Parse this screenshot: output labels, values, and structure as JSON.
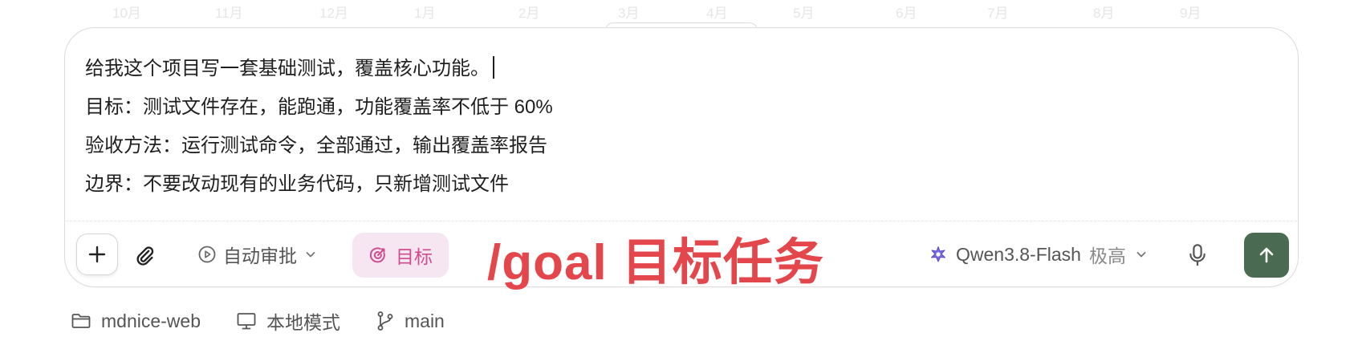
{
  "background_axis": [
    "10月",
    "11月",
    "12月",
    "1月",
    "2月",
    "3月",
    "4月",
    "5月",
    "6月",
    "7月",
    "8月",
    "9月"
  ],
  "composer": {
    "lines": [
      "给我这个项目写一套基础测试，覆盖核心功能。",
      "目标：测试文件存在，能跑通，功能覆盖率不低于 60%",
      "验收方法：运行测试命令，全部通过，输出覆盖率报告",
      "边界：不要改动现有的业务代码，只新增测试文件"
    ]
  },
  "toolbar": {
    "approve_label": "自动审批",
    "goal_label": "目标",
    "model_name": "Qwen3.8-Flash",
    "effort_label": "极高",
    "icons": [
      "plus-icon",
      "paperclip-icon",
      "play-circle-icon",
      "chevron-down-icon",
      "target-icon",
      "sparkle-icon",
      "microphone-icon",
      "arrow-up-icon"
    ]
  },
  "annotation": {
    "text": "/goal 目标任务"
  },
  "footer": {
    "project": "mdnice-web",
    "mode": "本地模式",
    "branch": "main"
  },
  "colors": {
    "send_button": "#4a6b52",
    "goal_pill_bg": "#f6e6f2",
    "goal_pill_text": "#cf4c8f",
    "annotation": "#e4474b",
    "model_icon": "#6b5bd6"
  }
}
